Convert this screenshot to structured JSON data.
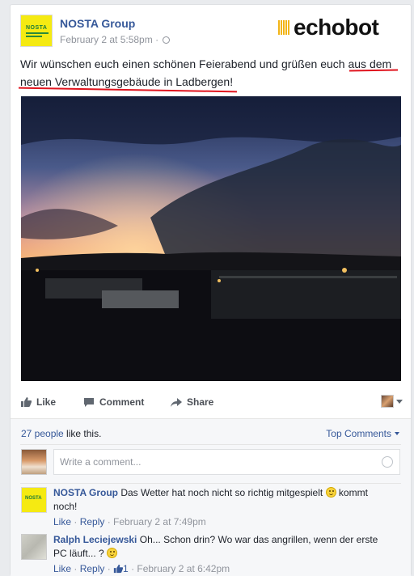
{
  "post": {
    "page_name": "NOSTA Group",
    "timestamp": "February 2 at 5:58pm",
    "separator": "·",
    "brand_logo": "echobot",
    "text": "Wir wünschen euch einen schönen Feierabend und grüßen euch aus dem neuen Verwaltungsgebäude in Ladbergen!",
    "avatar_text": "NOSTA"
  },
  "actions": {
    "like": "Like",
    "comment": "Comment",
    "share": "Share"
  },
  "ufi": {
    "likes_count": "27 people",
    "likes_suffix": " like this.",
    "top_comments": "Top Comments",
    "comment_placeholder": "Write a comment..."
  },
  "comments": [
    {
      "author": "NOSTA Group",
      "text_before": "Das Wetter hat noch nicht so richtig mitgespielt",
      "text_after": "kommt noch!",
      "like": "Like",
      "reply": "Reply",
      "time": "February 2 at 7:49pm"
    },
    {
      "author": "Ralph Leciejewski",
      "text_before": "Oh... Schon drin? Wo war das angrillen, wenn der erste PC läuft... ?",
      "like": "Like",
      "reply": "Reply",
      "likes": "1",
      "time": "February 2 at 6:42pm"
    }
  ],
  "colors": {
    "link": "#365899",
    "underline": "#e0141e",
    "nosta_yellow": "#f5ea12"
  }
}
